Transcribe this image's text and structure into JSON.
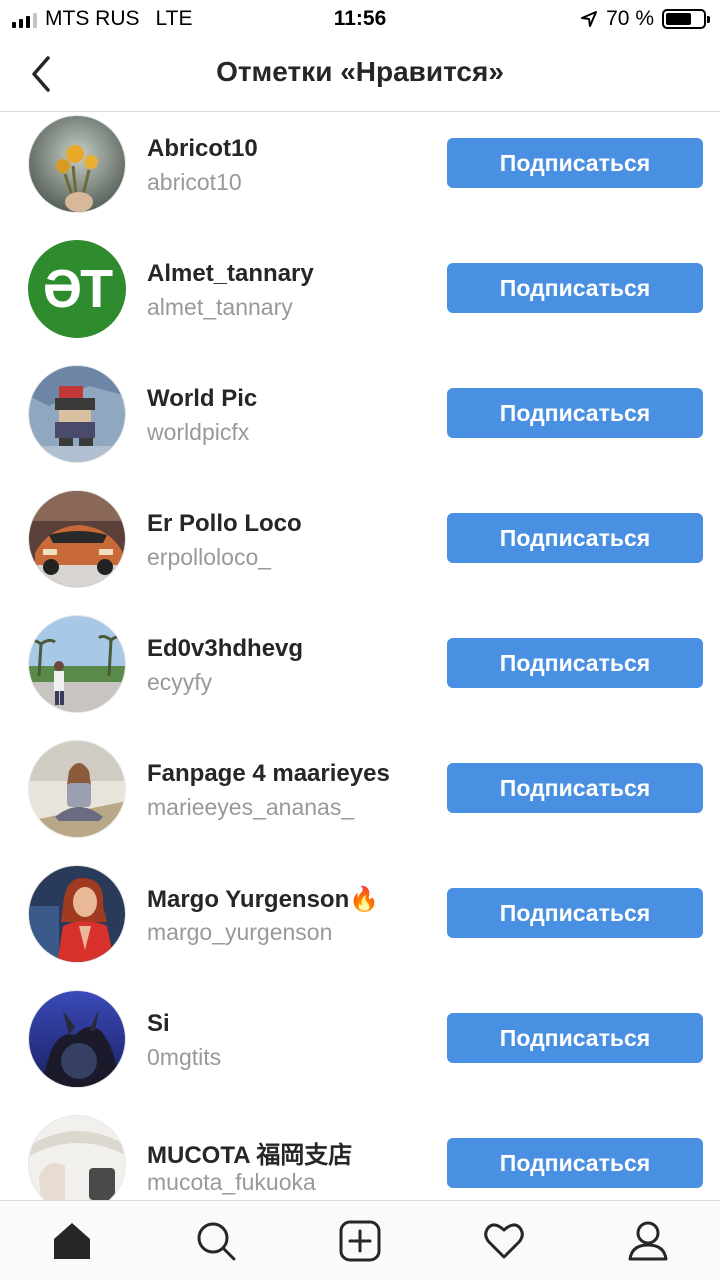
{
  "status": {
    "carrier": "MTS RUS",
    "network": "LTE",
    "time": "11:56",
    "battery_text": "70 %",
    "battery_level": 0.7
  },
  "header": {
    "title": "Отметки «Нравится»",
    "back_icon": "chevron-left-icon"
  },
  "users": [
    {
      "name": "Abricot10",
      "handle": "abricot10",
      "button": "Подписаться"
    },
    {
      "name": "Almet_tannary",
      "handle": "almet_tannary",
      "button": "Подписаться",
      "avatar_text": "ƏT"
    },
    {
      "name": "World Pic",
      "handle": "worldpicfx",
      "button": "Подписаться"
    },
    {
      "name": "Er Pollo Loco",
      "handle": "erpolloloco_",
      "button": "Подписаться"
    },
    {
      "name": "Ed0v3hdhevg",
      "handle": "ecyyfy",
      "button": "Подписаться"
    },
    {
      "name": "Fanpage 4 maarieyes",
      "handle": "marieeyes_ananas_",
      "button": "Подписаться"
    },
    {
      "name": "Margo Yurgenson🔥",
      "handle": "margo_yurgenson",
      "button": "Подписаться"
    },
    {
      "name": "Si",
      "handle": "0mgtits",
      "button": "Подписаться"
    },
    {
      "name": "MUCOTA 福岡支店",
      "handle": "mucota_fukuoka",
      "button": "Подписаться"
    }
  ],
  "colors": {
    "accent": "#4a90e2",
    "avatar_green": "#2e8b2e"
  },
  "tabs": [
    "home-icon",
    "search-icon",
    "add-post-icon",
    "heart-icon",
    "profile-icon"
  ]
}
